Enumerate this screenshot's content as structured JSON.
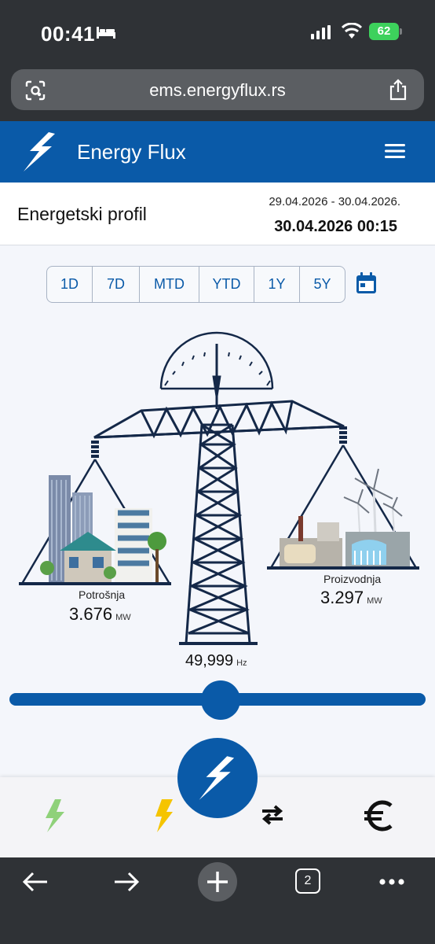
{
  "status_bar": {
    "time": "00:41",
    "battery": "62"
  },
  "browser": {
    "url": "ems.energyflux.rs",
    "tab_count": "2"
  },
  "app": {
    "title": "Energy Flux"
  },
  "profile": {
    "title": "Energetski profil",
    "date_range": "29.04.2026 - 30.04.2026.",
    "current_datetime": "30.04.2026 00:15"
  },
  "periods": [
    "1D",
    "7D",
    "MTD",
    "YTD",
    "1Y",
    "5Y"
  ],
  "balance": {
    "consumption_label": "Potrošnja",
    "consumption_value": "3.676",
    "consumption_unit": "MW",
    "production_label": "Proizvodnja",
    "production_value": "3.297",
    "production_unit": "MW",
    "frequency_value": "49,999",
    "frequency_unit": "Hz"
  },
  "slider": {
    "level_fraction": 0.5
  },
  "bottom_nav": {
    "items": [
      "renewable-energy-icon",
      "power-icon",
      "exchange-arrows-icon",
      "euro-icon"
    ],
    "center": "energy-flux-logo-icon"
  },
  "colors": {
    "brand_blue": "#0a5aa8",
    "scale_navy": "#142848",
    "battery_green": "#3dd15c",
    "renewable_green": "#8fd17a",
    "power_yellow": "#f5c400"
  }
}
